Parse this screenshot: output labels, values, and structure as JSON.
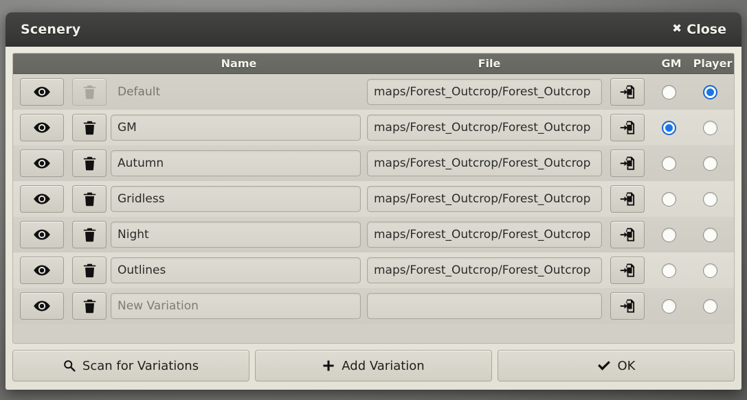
{
  "window": {
    "title": "Scenery",
    "close_label": "Close",
    "close_icon": "close-x-icon"
  },
  "table": {
    "headers": {
      "eye": "",
      "trash": "",
      "name": "Name",
      "file": "File",
      "browse": "",
      "gm": "GM",
      "player": "Player"
    },
    "icons": {
      "eye": "eye-icon",
      "trash": "trash-icon",
      "browse": "file-import-icon"
    },
    "rows": [
      {
        "name": "Default",
        "name_placeholder": "",
        "name_readonly": true,
        "trash_enabled": false,
        "file": "maps/Forest_Outcrop/Forest_Outcrop",
        "gm": false,
        "player": true
      },
      {
        "name": "GM",
        "name_placeholder": "",
        "name_readonly": false,
        "trash_enabled": true,
        "file": "maps/Forest_Outcrop/Forest_Outcrop",
        "gm": true,
        "player": false
      },
      {
        "name": "Autumn",
        "name_placeholder": "",
        "name_readonly": false,
        "trash_enabled": true,
        "file": "maps/Forest_Outcrop/Forest_Outcrop",
        "gm": false,
        "player": false
      },
      {
        "name": "Gridless",
        "name_placeholder": "",
        "name_readonly": false,
        "trash_enabled": true,
        "file": "maps/Forest_Outcrop/Forest_Outcrop",
        "gm": false,
        "player": false
      },
      {
        "name": "Night",
        "name_placeholder": "",
        "name_readonly": false,
        "trash_enabled": true,
        "file": "maps/Forest_Outcrop/Forest_Outcrop",
        "gm": false,
        "player": false
      },
      {
        "name": "Outlines",
        "name_placeholder": "",
        "name_readonly": false,
        "trash_enabled": true,
        "file": "maps/Forest_Outcrop/Forest_Outcrop",
        "gm": false,
        "player": false
      },
      {
        "name": "",
        "name_placeholder": "New Variation",
        "name_readonly": false,
        "trash_enabled": true,
        "file": "",
        "gm": false,
        "player": false
      }
    ]
  },
  "footer": {
    "buttons": [
      {
        "label": "Scan for Variations",
        "icon": "search-icon"
      },
      {
        "label": "Add Variation",
        "icon": "plus-icon"
      },
      {
        "label": "OK",
        "icon": "check-icon"
      }
    ]
  },
  "colors": {
    "accent": "#1a76e8",
    "titlebar": "#3b3b39",
    "body": "#e9e7dc",
    "header_row": "#6a6a65"
  }
}
